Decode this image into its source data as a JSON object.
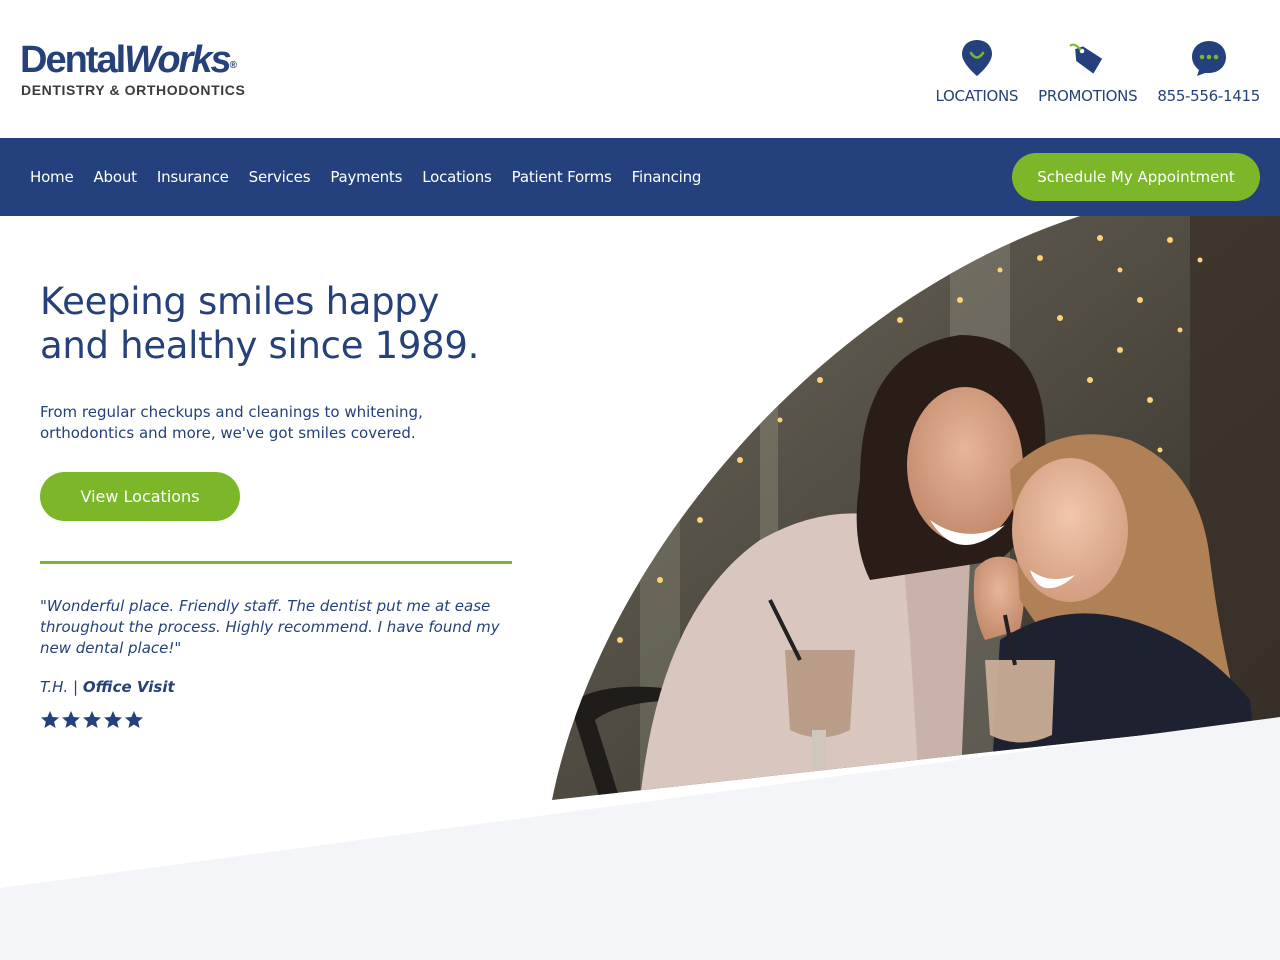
{
  "logo": {
    "brand_part1": "Dental",
    "brand_part2": "Works",
    "registered": "®",
    "tagline": "DENTISTRY & ORTHODONTICS"
  },
  "header_links": {
    "locations": {
      "label": "LOCATIONS",
      "icon": "location-pin-icon"
    },
    "promotions": {
      "label": "PROMOTIONS",
      "icon": "tag-icon"
    },
    "phone": {
      "label": "855-556-1415",
      "icon": "chat-bubble-icon"
    }
  },
  "nav": {
    "items": [
      "Home",
      "About",
      "Insurance",
      "Services",
      "Payments",
      "Locations",
      "Patient Forms",
      "Financing"
    ],
    "cta": "Schedule My Appointment"
  },
  "hero": {
    "title_line1": "Keeping smiles happy",
    "title_line2": "and healthy since 1989.",
    "body": "From regular checkups and cleanings to whitening, orthodontics and more, we've got smiles covered.",
    "button": "View Locations",
    "photo_icon": "mother-daughter-photo"
  },
  "testimonial": {
    "quote": "\"Wonderful place. Friendly staff. The dentist put me at ease throughout the process. Highly recommend. I have found my new dental place!\"",
    "author": "T.H.",
    "separator": "|",
    "source": "Office Visit",
    "rating": 5,
    "rating_max": 5
  },
  "colors": {
    "navy": "#24417d",
    "green": "#7cb72a",
    "band": "#f3f5f8"
  }
}
